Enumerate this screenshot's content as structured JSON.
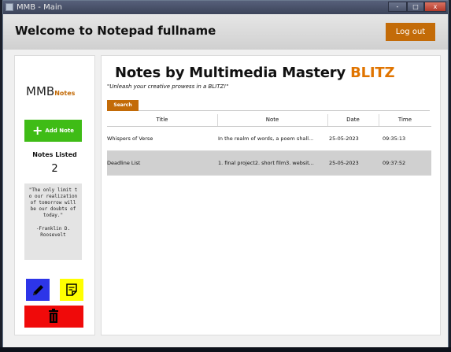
{
  "window": {
    "title": "MMB - Main",
    "controls": {
      "minimize": "-",
      "maximize": "□",
      "close": "x"
    }
  },
  "header": {
    "welcome_text": "Welcome to Notepad  fullname",
    "logout_label": "Log out"
  },
  "sidebar": {
    "logo_main": "MMB",
    "logo_sub": "Notes",
    "add_note_label": "Add Note",
    "add_note_icon": "plus-icon",
    "notes_listed_label": "Notes Listed",
    "notes_listed_count": "2",
    "quote_text": "\"The only limit t o our realization of tomorrow will be our doubts of today.\"",
    "quote_author": "-Franklin D. Roosevelt",
    "edit_icon": "pencil-icon",
    "note_icon": "sticky-note-icon",
    "delete_icon": "trash-icon"
  },
  "main": {
    "title_prefix": "Notes by Multimedia Mastery ",
    "title_accent": "BLITZ",
    "tagline": "\"Unleash your creative prowess in a BLITZ!\"",
    "search_label": "Search",
    "columns": [
      "Title",
      "Note",
      "Date",
      "Time"
    ],
    "rows": [
      {
        "title": "Whispers of Verse",
        "note": "In the realm of words, a poem shall...",
        "date": "25-05-2023",
        "time": "09:35:13",
        "selected": false
      },
      {
        "title": "Deadline List",
        "note": "1. final project2. short film3. websit...",
        "date": "25-05-2023",
        "time": "09:37:52",
        "selected": true
      }
    ]
  },
  "colors": {
    "accent_orange": "#c36b08",
    "add_green": "#3fbc16",
    "edit_blue": "#2d35e8",
    "note_yellow": "#ffff00",
    "delete_red": "#f00a0a"
  }
}
